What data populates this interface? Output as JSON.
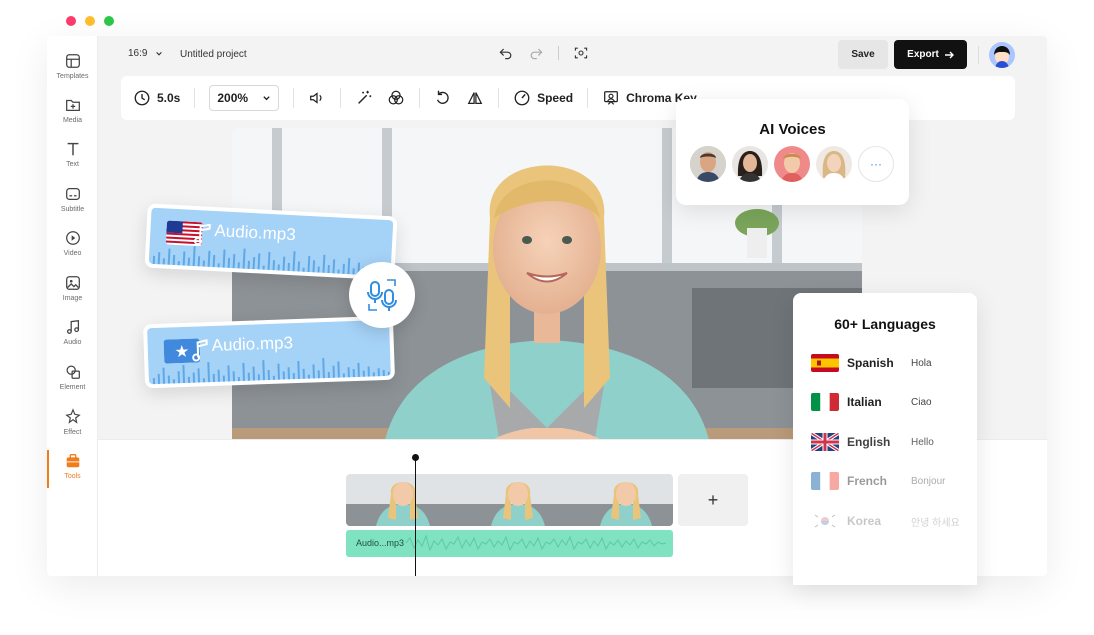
{
  "window_controls": {
    "colors": [
      "#ff3b6b",
      "#ffbe2e",
      "#2bc84a"
    ]
  },
  "sidebar": {
    "items": [
      {
        "label": "Templates",
        "icon": "templates-icon"
      },
      {
        "label": "Media",
        "icon": "media-icon"
      },
      {
        "label": "Text",
        "icon": "text-icon"
      },
      {
        "label": "Subtitle",
        "icon": "subtitle-icon"
      },
      {
        "label": "Video",
        "icon": "video-icon"
      },
      {
        "label": "Image",
        "icon": "image-icon"
      },
      {
        "label": "Audio",
        "icon": "audio-icon"
      },
      {
        "label": "Element",
        "icon": "element-icon"
      },
      {
        "label": "Effect",
        "icon": "effect-icon"
      },
      {
        "label": "Tools",
        "icon": "tools-icon",
        "active": true
      }
    ],
    "active_color": "#f07d1b"
  },
  "header": {
    "aspect_ratio": "16:9",
    "project_title": "Untitled project",
    "save_label": "Save",
    "export_label": "Export"
  },
  "toolbar": {
    "duration": "5.0s",
    "zoom": "200%",
    "speed_label": "Speed",
    "chroma_key_label": "Chroma Key"
  },
  "ai_voices": {
    "title": "AI Voices",
    "more_label": "···"
  },
  "audio_cards": [
    {
      "name": "Audio.mp3",
      "flag": "us-flag"
    },
    {
      "name": "Audio.mp3",
      "flag": "somalia-flag"
    }
  ],
  "languages": {
    "title": "60+ Languages",
    "items": [
      {
        "name": "Spanish",
        "greeting": "Hola"
      },
      {
        "name": "Italian",
        "greeting": "Ciao"
      },
      {
        "name": "English",
        "greeting": "Hello"
      },
      {
        "name": "French",
        "greeting": "Bonjour"
      },
      {
        "name": "Korea",
        "greeting": "안녕 하세요"
      }
    ]
  },
  "timeline": {
    "audio_track_label": "Audio...mp3",
    "add_label": "+"
  }
}
